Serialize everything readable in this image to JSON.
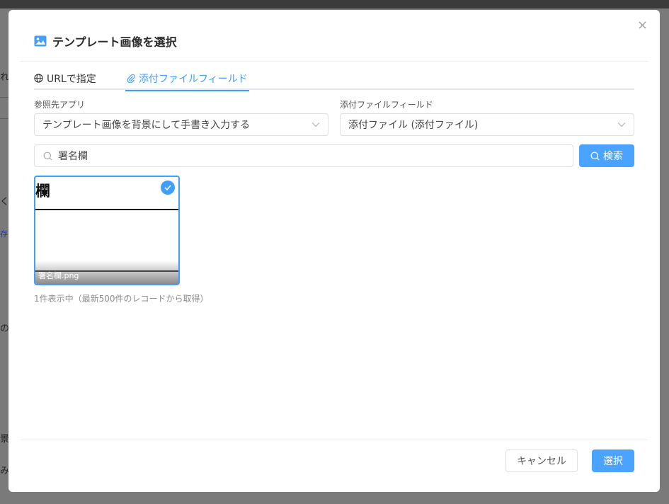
{
  "background": {
    "fragments": [
      "れ",
      "く",
      "存",
      "の",
      "景",
      "み"
    ]
  },
  "dialog": {
    "title": "テンプレート画像を選択",
    "title_icon": "image-icon",
    "close_icon": "close-icon"
  },
  "tabs": [
    {
      "label": "URLで指定",
      "icon": "globe-icon",
      "active": false
    },
    {
      "label": "添付ファイルフィールド",
      "icon": "paperclip-icon",
      "active": true
    }
  ],
  "form": {
    "app_label": "参照先アプリ",
    "app_value": "テンプレート画像を背景にして手書き入力する",
    "field_label": "添付ファイルフィールド",
    "field_value": "添付ファイル (添付ファイル)"
  },
  "search": {
    "value": "署名欄",
    "button_label": "検索"
  },
  "results": {
    "items": [
      {
        "preview_text": "欄",
        "filename": "署名欄.png",
        "selected": true
      }
    ],
    "note": "1件表示中（最新500件のレコードから取得）"
  },
  "footer": {
    "cancel_label": "キャンセル",
    "select_label": "選択"
  },
  "colors": {
    "accent": "#409eff",
    "button_primary": "#4aa3ff",
    "overlay": "#7a7a7a"
  }
}
